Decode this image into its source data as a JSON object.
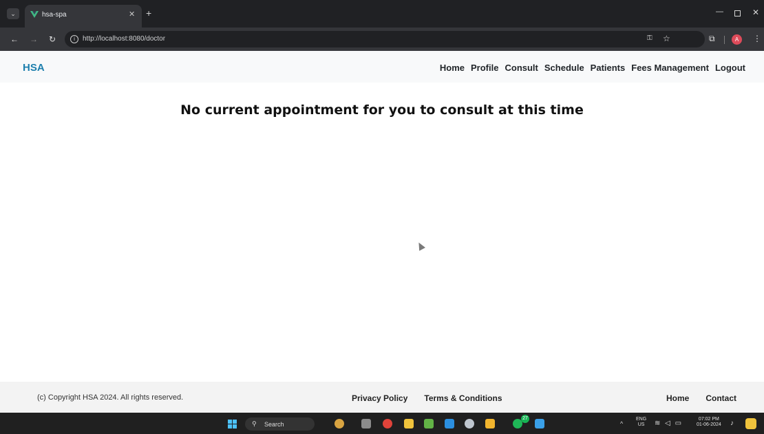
{
  "browser": {
    "tab_title": "hsa-spa",
    "url": "http://localhost:8080/doctor"
  },
  "header": {
    "brand": "HSA",
    "nav": [
      "Home",
      "Profile",
      "Consult",
      "Schedule",
      "Patients",
      "Fees Management",
      "Logout"
    ]
  },
  "main": {
    "message": "No current appointment for you to consult at this time"
  },
  "footer": {
    "copyright": "(c) Copyright HSA 2024. All rights reserved.",
    "links_center": [
      "Privacy Policy",
      "Terms & Conditions"
    ],
    "links_right": [
      "Home",
      "Contact"
    ]
  },
  "taskbar": {
    "search_label": "Search",
    "whatsapp_badge": "27",
    "language": "ENG",
    "region": "US",
    "time": "07:02 PM",
    "date": "01-06-2024"
  },
  "colors": {
    "brand": "#1d7fad",
    "avatar": "#dd4b5a",
    "avatar_letter": "A"
  }
}
